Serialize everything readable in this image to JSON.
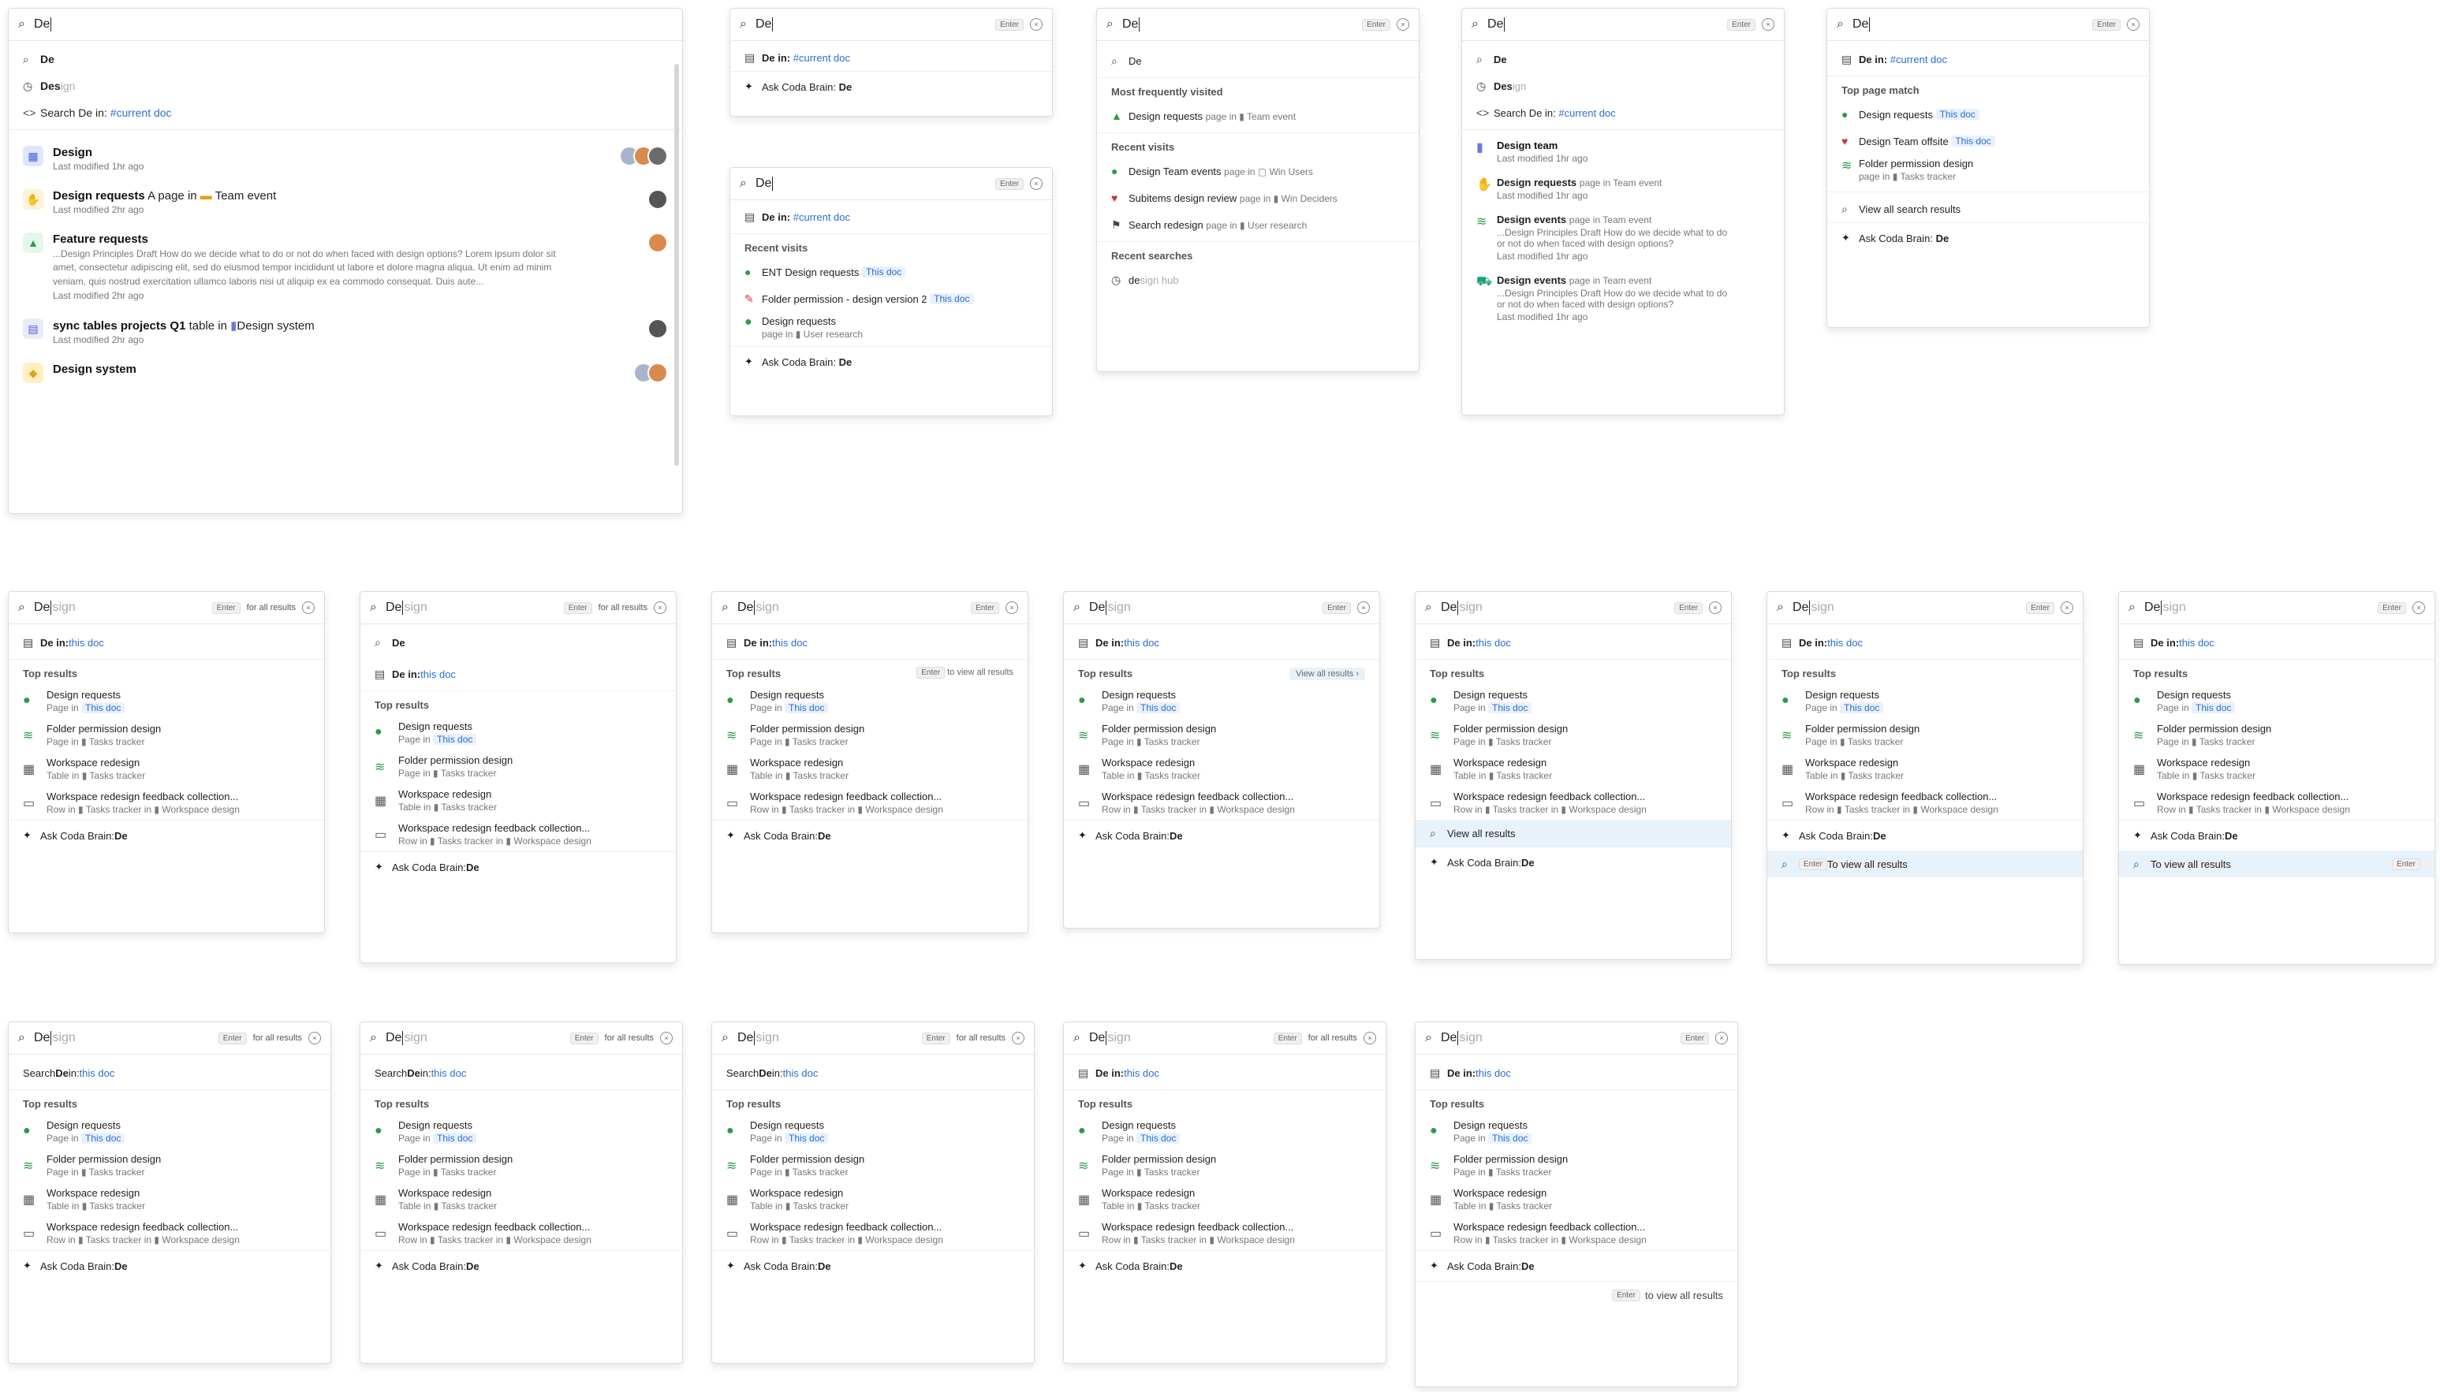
{
  "p1": {
    "query": "De",
    "suggestions": [
      {
        "icon": "search-icon",
        "text": "De"
      },
      {
        "icon": "clock-icon",
        "text": "Des",
        "ghost": "ign"
      },
      {
        "icon": "code-icon",
        "text": "Search De in: ",
        "link": "#current doc"
      }
    ],
    "results": [
      {
        "title": "Design",
        "meta": "Last modified 1hr ago"
      },
      {
        "title": "Design requests",
        "context": "A page in",
        "parent": "Team event",
        "meta": "Last modified 2hr ago"
      },
      {
        "title": "Feature requests",
        "snippet": "...Design Principles Draft How do we decide what to do or not do when faced with design options? Lorem ipsum dolor sit amet, consectetur adipiscing elit, sed do eiusmod tempor incididunt ut labore et dolore magna aliqua. Ut enim ad minim veniam, quis nostrud exercitation ullamco laboris nisi ut aliquip ex ea commodo consequat. Duis aute...",
        "meta": "Last modified 2hr ago"
      },
      {
        "title": "sync tables projects Q1",
        "context": "table in",
        "parent": "Design system",
        "meta": "Last modified 2hr ago"
      },
      {
        "title": "Design system"
      }
    ]
  },
  "p2": {
    "query": "De",
    "enter": "Enter",
    "scope_prefix": "De in: ",
    "scope_link": "#current doc",
    "brain_prefix": "Ask Coda Brain: ",
    "brain_term": "De"
  },
  "p3": {
    "query": "De",
    "enter": "Enter",
    "scope_prefix": "De in: ",
    "scope_link": "#current doc",
    "header": "Recent visits",
    "items": [
      {
        "title": "ENT Design requests",
        "tag": "This doc"
      },
      {
        "title": "Folder permission - design version 2",
        "tag": "This doc"
      },
      {
        "title": "Design requests",
        "sub": "page in",
        "parent": "User research"
      }
    ],
    "brain_prefix": "Ask Coda Brain: ",
    "brain_term": "De"
  },
  "p4": {
    "query": "De",
    "enter": "Enter",
    "first": "De",
    "freq_header": "Most frequently visited",
    "freq": [
      {
        "title": "Design requests",
        "sub": "page in",
        "parent": "Team event"
      }
    ],
    "recent_header": "Recent visits",
    "recent": [
      {
        "title": "Design Team events",
        "sub": "page in",
        "parent": "Win Users"
      },
      {
        "title": "Subitems design review",
        "sub": "page in",
        "parent": "Win Deciders"
      },
      {
        "title": "Search redesign",
        "sub": "page in",
        "parent": "User research"
      }
    ],
    "searches_header": "Recent searches",
    "searches": [
      {
        "text": "de",
        "ghost": "sign hub"
      }
    ]
  },
  "p5": {
    "query": "De",
    "enter": "Enter",
    "suggestions": [
      {
        "text": "De"
      },
      {
        "text": "Des",
        "ghost": "ign"
      },
      {
        "text": "Search De in: ",
        "link": "#current doc"
      }
    ],
    "results": [
      {
        "title": "Design team",
        "meta": "Last modified 1hr ago"
      },
      {
        "title": "Design requests",
        "sub": "page in",
        "parent": "Team event",
        "meta": "Last modified 1hr ago"
      },
      {
        "title": "Design events",
        "sub": "page in",
        "parent": "Team event",
        "snippet": "...Design Principles Draft How do we decide what to do or not do when faced with design options?",
        "meta": "Last modified 1hr ago"
      },
      {
        "title": "Design events",
        "sub": "page in",
        "parent": "Team event",
        "snippet": "...Design Principles Draft How do we decide what to do or not do when faced with design options?",
        "meta": "Last modified 1hr ago"
      }
    ]
  },
  "p6": {
    "query": "De",
    "enter": "Enter",
    "scope_prefix": "De in: ",
    "scope_link": "#current doc",
    "header": "Top page match",
    "items": [
      {
        "title": "Design requests",
        "tag": "This doc"
      },
      {
        "title": "Design Team offsite",
        "tag": "This doc"
      },
      {
        "title": "Folder permission design",
        "sub": "page in",
        "parent": "Tasks tracker"
      }
    ],
    "view_all": "View all search results",
    "brain_prefix": "Ask Coda Brain: ",
    "brain_term": "De"
  },
  "variant_common": {
    "query": "De",
    "ghost": "sign",
    "enter": "Enter",
    "for_all": "for all results",
    "scope_prefix": "De in: ",
    "scope_link": "this doc",
    "top_results": "Top results",
    "results": [
      {
        "title": "Design requests",
        "sub": "Page in",
        "tag": "This doc"
      },
      {
        "title": "Folder permission design",
        "sub": "Page in",
        "parent": "Tasks tracker"
      },
      {
        "title": "Workspace redesign",
        "sub": "Table in",
        "parent": "Tasks tracker"
      },
      {
        "title": "Workspace redesign feedback collection...",
        "sub": "Row in",
        "parent": "Tasks tracker",
        "parent2": "Workspace design"
      }
    ],
    "brain_prefix": "Ask Coda Brain: ",
    "brain_term": "De",
    "view_all": "View all results",
    "to_view_all": "to view all results",
    "To_view_all": "To view all results",
    "search_prefix": "Search ",
    "search_term": "De",
    "search_in": " in: "
  }
}
